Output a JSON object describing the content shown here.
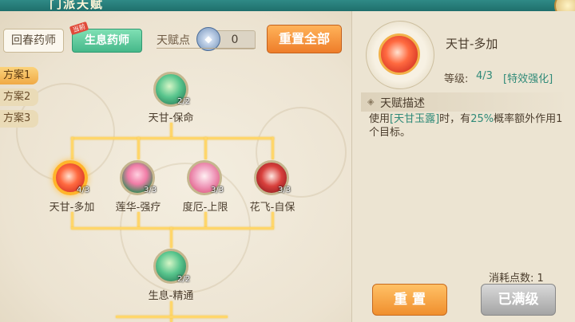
{
  "window": {
    "title": "门派天赋"
  },
  "subclass_tabs": [
    {
      "label": "回春药师"
    },
    {
      "label": "生息药师",
      "badge": "当前"
    }
  ],
  "talent_points": {
    "label": "天赋点",
    "value": "0"
  },
  "reset_all_label": "重置全部",
  "plans": [
    "方案1",
    "方案2",
    "方案3"
  ],
  "tree": {
    "root": {
      "name": "天甘-保命",
      "level": "2/2"
    },
    "row2": [
      {
        "name": "天甘-多加",
        "level": "4/3"
      },
      {
        "name": "莲华-强疗",
        "level": "3/3"
      },
      {
        "name": "度厄-上限",
        "level": "3/3"
      },
      {
        "name": "花飞-自保",
        "level": "3/3"
      }
    ],
    "bottom": {
      "name": "生息-精通",
      "level": "2/2"
    }
  },
  "detail": {
    "name": "天甘-多加",
    "level_label": "等级:",
    "level_value": "4/3",
    "level_tag": "[特效强化]",
    "desc_title": "天赋描述",
    "desc_parts": {
      "p1": "使用",
      "skill": "[天甘玉露]",
      "p2": "时，有",
      "pct": "25%",
      "p3": "概率额外作用1个目标。"
    },
    "cost": "消耗点数: 1",
    "reset_label": "重 置",
    "max_label": "已满级"
  },
  "colors": {
    "accent_green": "#2f8a78",
    "gold": "#ffd66a",
    "orange": "#f08f2e"
  }
}
